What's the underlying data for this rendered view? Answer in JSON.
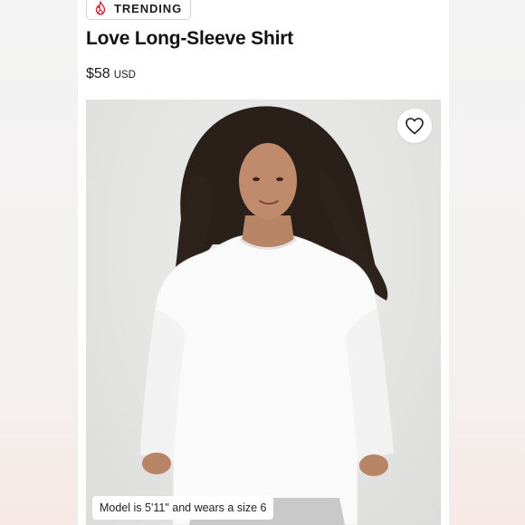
{
  "badge": {
    "label": "TRENDING",
    "icon": "flame-icon",
    "icon_color": "#d2293b"
  },
  "product": {
    "title": "Love Long-Sleeve Shirt",
    "price": "$58",
    "currency": "USD"
  },
  "image": {
    "caption": "Model is 5'11\" and wears a size 6",
    "favorite_icon": "heart-outline-icon"
  }
}
